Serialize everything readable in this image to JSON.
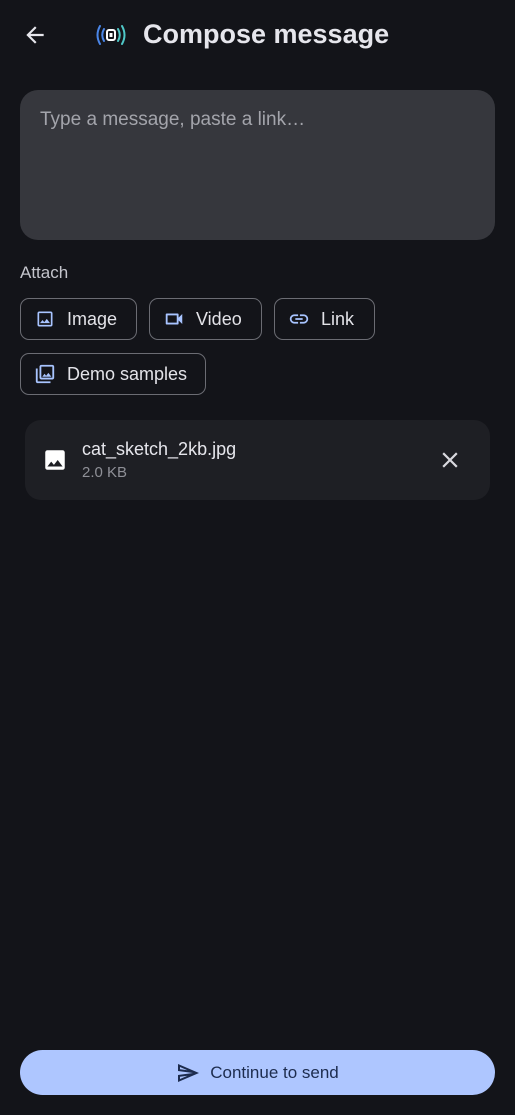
{
  "header": {
    "back_icon": "arrow-left-icon",
    "logo_icon": "broadcast-icon",
    "title": "Compose message"
  },
  "composer": {
    "value": "",
    "placeholder": "Type a message, paste a link…"
  },
  "attach": {
    "label": "Attach",
    "options": [
      {
        "label": "Image",
        "icon": "image-icon"
      },
      {
        "label": "Video",
        "icon": "video-icon"
      },
      {
        "label": "Link",
        "icon": "link-icon"
      },
      {
        "label": "Demo samples",
        "icon": "photo-library-icon"
      }
    ]
  },
  "attachments": [
    {
      "name": "cat_sketch_2kb.jpg",
      "size": "2.0 KB",
      "icon": "image-icon",
      "remove_icon": "close-icon"
    }
  ],
  "footer": {
    "send_label": "Continue to send",
    "send_icon": "send-icon"
  },
  "colors": {
    "background": "#131419",
    "surface": "#36373d",
    "card": "#1e1f24",
    "accent": "#aec6ff",
    "icon_accent": "#a8c4ff",
    "logo_teal": "#4fc8c8",
    "logo_blue": "#4a86e8"
  }
}
